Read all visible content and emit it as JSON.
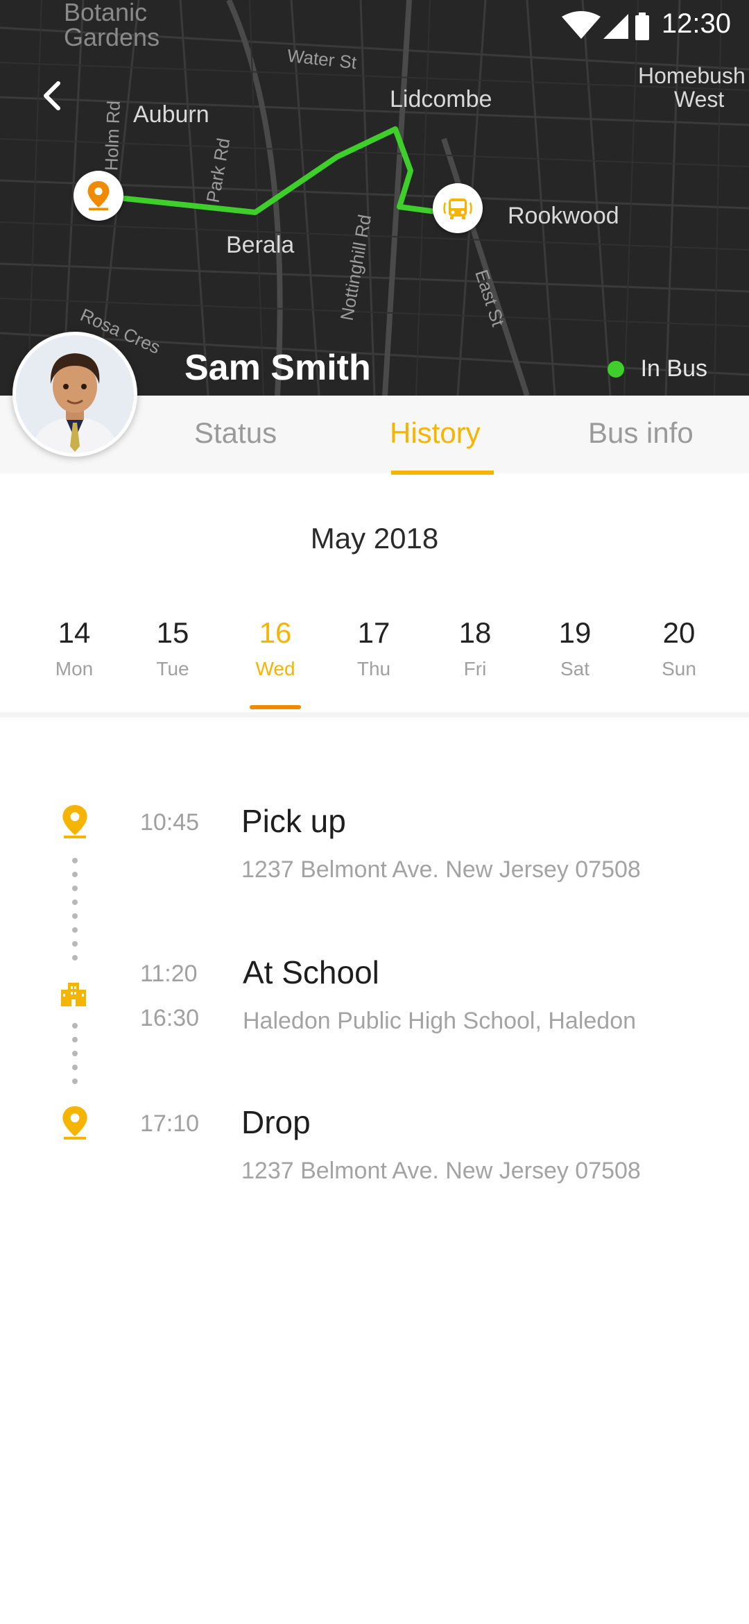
{
  "status_bar": {
    "time": "12:30"
  },
  "map": {
    "labels": {
      "botanic": "Botanic\nGardens",
      "water_st": "Water St",
      "homebush": "Homebush\nWest",
      "auburn": "Auburn",
      "lidcombe": "Lidcombe",
      "rookwood": "Rookwood",
      "berala": "Berala",
      "park_rd": "Park Rd",
      "holm_rd": "Holm Rd",
      "nottinghill": "Nottinghill Rd",
      "east_st": "East St",
      "rosa_cres": "Rosa Cres"
    },
    "route_color": "#3ecf2b"
  },
  "profile": {
    "name": "Sam Smith",
    "status": "In Bus",
    "status_color": "#3ecf2b"
  },
  "tabs": [
    {
      "label": "Status",
      "active": false
    },
    {
      "label": "History",
      "active": true
    },
    {
      "label": "Bus info",
      "active": false
    }
  ],
  "calendar": {
    "month": "May 2018",
    "days": [
      {
        "num": "14",
        "name": "Mon"
      },
      {
        "num": "15",
        "name": "Tue"
      },
      {
        "num": "16",
        "name": "Wed",
        "selected": true
      },
      {
        "num": "17",
        "name": "Thu"
      },
      {
        "num": "18",
        "name": "Fri"
      },
      {
        "num": "19",
        "name": "Sat"
      },
      {
        "num": "20",
        "name": "Sun"
      }
    ]
  },
  "timeline": [
    {
      "times": [
        "10:45"
      ],
      "title": "Pick up",
      "address": "1237 Belmont Ave. New Jersey 07508",
      "icon": "location-pin-icon"
    },
    {
      "times": [
        "11:20",
        "16:30"
      ],
      "title": "At School",
      "address": "Haledon Public High School, Haledon",
      "icon": "school-building-icon"
    },
    {
      "times": [
        "17:10"
      ],
      "title": "Drop",
      "address": "1237 Belmont Ave. New Jersey 07508",
      "icon": "location-pin-icon"
    }
  ],
  "colors": {
    "accent": "#f5b400",
    "selected_underline": "#f08a00",
    "route": "#3ecf2b"
  }
}
